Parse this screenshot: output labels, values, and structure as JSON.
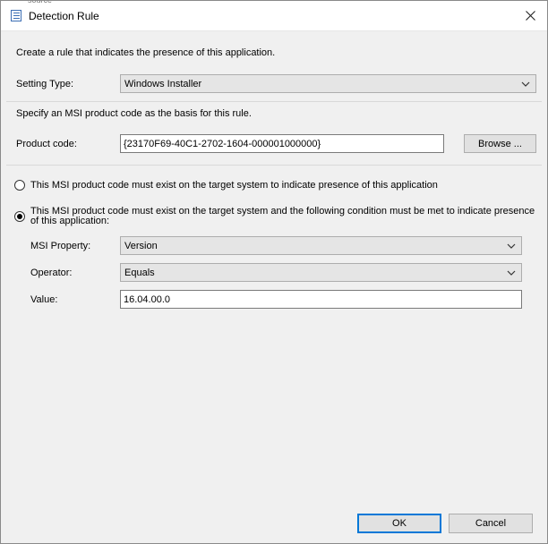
{
  "window": {
    "peek_text": "source",
    "title": "Detection Rule",
    "close_glyph": "close-icon"
  },
  "intro_text": "Create a rule that indicates the presence of this application.",
  "setting_type": {
    "label": "Setting Type:",
    "value": "Windows Installer"
  },
  "msi_hint": "Specify an MSI product code as the basis for this rule.",
  "product_code": {
    "label": "Product code:",
    "value": "{23170F69-40C1-2702-1604-000001000000}",
    "browse_label": "Browse ..."
  },
  "radios": [
    {
      "label": "This MSI product code must exist on the target system to indicate presence of this application",
      "checked": false
    },
    {
      "label": "This MSI product code must exist on the target system and the following condition must be met to indicate presence of this application:",
      "checked": true
    }
  ],
  "condition": {
    "msi_property_label": "MSI Property:",
    "msi_property_value": "Version",
    "operator_label": "Operator:",
    "operator_value": "Equals",
    "value_label": "Value:",
    "value_value": "16.04.00.0"
  },
  "footer": {
    "ok_label": "OK",
    "cancel_label": "Cancel"
  }
}
